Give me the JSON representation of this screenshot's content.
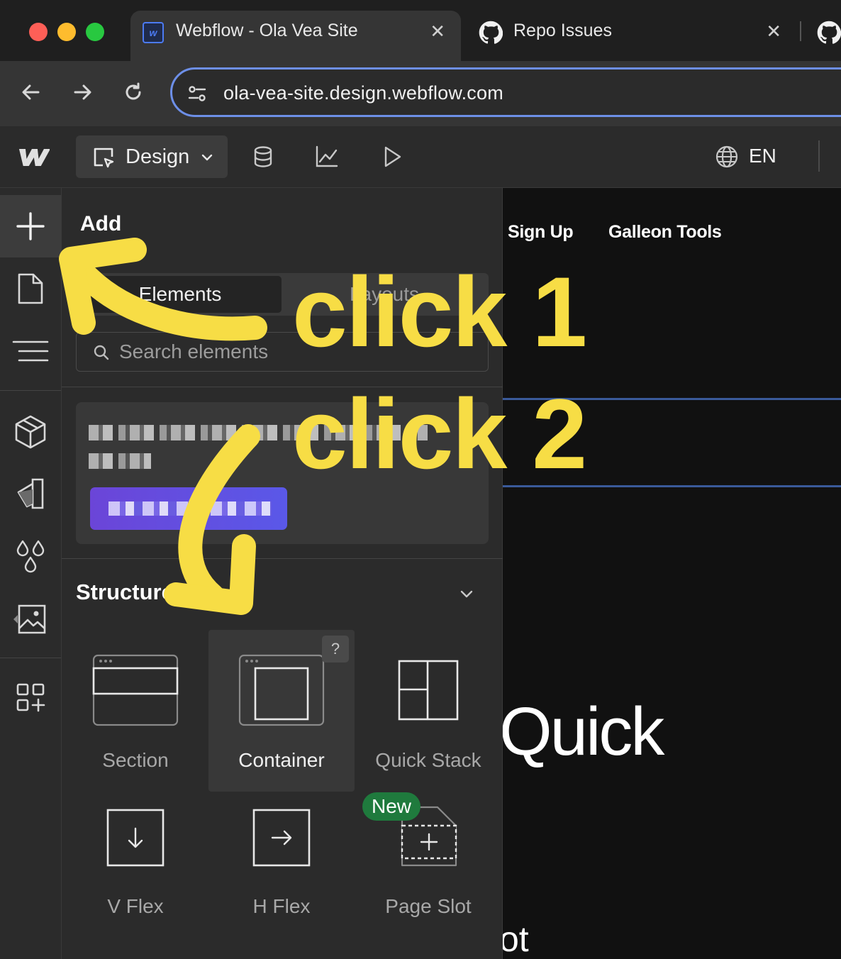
{
  "browser": {
    "tabs": [
      {
        "title": "Webflow - Ola Vea Site",
        "active": true,
        "favicon": "webflow-favicon",
        "close": "✕"
      },
      {
        "title": "Repo Issues",
        "active": false,
        "favicon": "github-icon",
        "close": "✕"
      }
    ],
    "url": "ola-vea-site.design.webflow.com",
    "accent_color": "#6d8fe8"
  },
  "webflow": {
    "mode_label": "Design",
    "language": "EN",
    "topbar_icons": [
      "cms-database-icon",
      "analytics-chart-icon",
      "preview-play-icon",
      "globe-icon"
    ],
    "rail_icons": [
      "add-plus-icon",
      "pages-icon",
      "navigator-icon",
      "components-box-icon",
      "style-selector-icon",
      "variables-drops-icon",
      "assets-image-icon",
      "apps-icon"
    ]
  },
  "add_panel": {
    "title": "Add",
    "tabs": [
      "Elements",
      "Layouts"
    ],
    "search_placeholder": "Search elements",
    "structure_title": "Structure",
    "elements": [
      {
        "label": "Section",
        "icon": "section-icon"
      },
      {
        "label": "Container",
        "icon": "container-icon",
        "help": "?"
      },
      {
        "label": "Quick Stack",
        "icon": "quick-stack-icon"
      },
      {
        "label": "V Flex",
        "icon": "v-flex-icon"
      },
      {
        "label": "H Flex",
        "icon": "h-flex-icon"
      },
      {
        "label": "Page Slot",
        "icon": "page-slot-icon",
        "badge": "New"
      }
    ]
  },
  "canvas": {
    "nav_links": [
      "Sign Up",
      "Galleon Tools"
    ],
    "heading": "Quick",
    "tail_text": "ot"
  },
  "annotations": {
    "click_1": "click 1",
    "click_2": "click 2",
    "color": "#f7dd45"
  }
}
